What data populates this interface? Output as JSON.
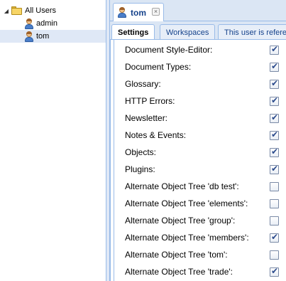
{
  "tree": {
    "root": {
      "label": "All Users",
      "expanded": true,
      "icon": "folder-icon"
    },
    "users": [
      {
        "label": "admin",
        "icon": "user-icon",
        "selected": false
      },
      {
        "label": "tom",
        "icon": "user-icon",
        "selected": true
      }
    ]
  },
  "document_tab": {
    "label": "tom",
    "close_glyph": "×"
  },
  "subtabs": [
    {
      "label": "Settings",
      "active": true
    },
    {
      "label": "Workspaces",
      "active": false
    },
    {
      "label": "This user is referenced",
      "active": false
    }
  ],
  "permissions": [
    {
      "label": "Document Style-Editor:",
      "checked": true
    },
    {
      "label": "Document Types:",
      "checked": true
    },
    {
      "label": "Glossary:",
      "checked": true
    },
    {
      "label": "HTTP Errors:",
      "checked": true
    },
    {
      "label": "Newsletter:",
      "checked": true
    },
    {
      "label": "Notes & Events:",
      "checked": true
    },
    {
      "label": "Objects:",
      "checked": true
    },
    {
      "label": "Plugins:",
      "checked": true
    },
    {
      "label": "Alternate Object Tree 'db test':",
      "checked": false
    },
    {
      "label": "Alternate Object Tree 'elements':",
      "checked": false
    },
    {
      "label": "Alternate Object Tree 'group':",
      "checked": false
    },
    {
      "label": "Alternate Object Tree 'members':",
      "checked": true
    },
    {
      "label": "Alternate Object Tree 'tom':",
      "checked": false
    },
    {
      "label": "Alternate Object Tree 'trade':",
      "checked": true
    }
  ],
  "colors": {
    "panel_border": "#99bbe8",
    "tab_bar_bg": "#dbe6f4",
    "selected_row_bg": "#dfe8f6",
    "tab_text": "#15428b"
  }
}
